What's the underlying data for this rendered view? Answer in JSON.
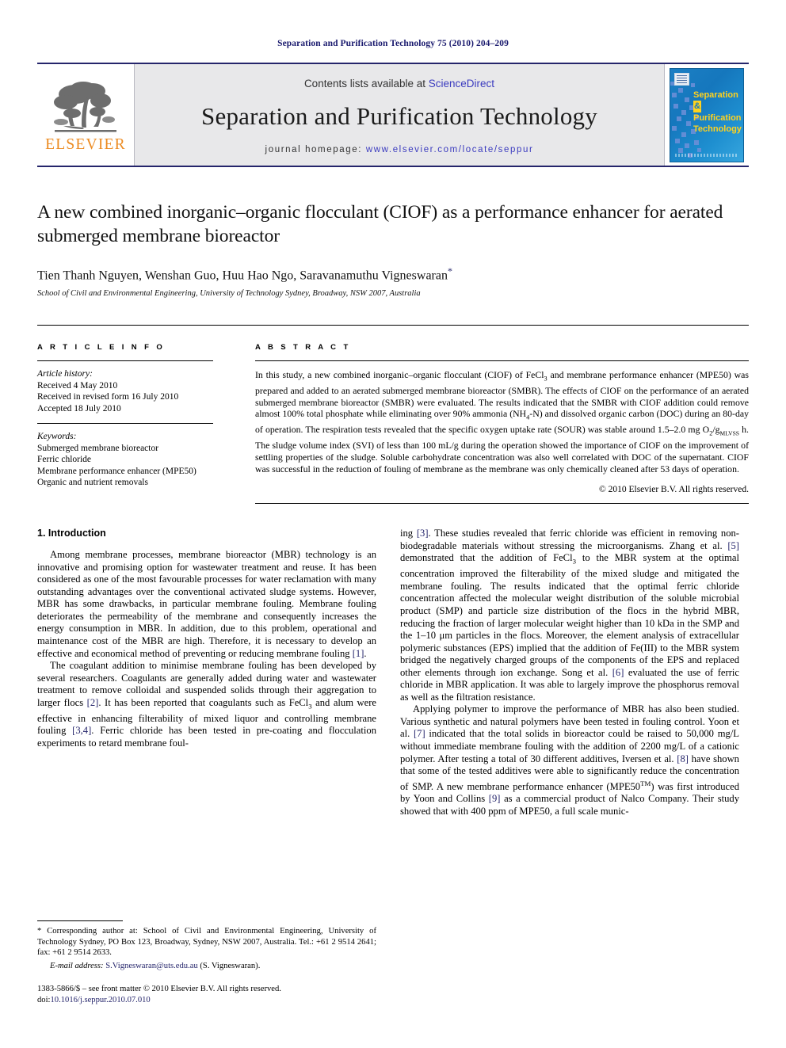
{
  "running_head": "Separation and Purification Technology 75 (2010) 204–209",
  "masthead": {
    "contents_prefix": "Contents lists available at ",
    "sciencedirect": "ScienceDirect",
    "journal_title": "Separation and Purification Technology",
    "homepage_label": "journal homepage:",
    "homepage_url": "www.elsevier.com/locate/seppur",
    "publisher_wordmark": "ELSEVIER",
    "publisher_color": "#ec8b22",
    "link_color": "#3b3bbf",
    "cover": {
      "line1": "Separation",
      "amp": "&",
      "line2": "Purification",
      "line3": "Technology",
      "text_color": "#ffd21e",
      "background_color": "#1577bd"
    }
  },
  "article": {
    "title": "A new combined inorganic–organic flocculant (CIOF) as a performance enhancer for aerated submerged membrane bioreactor",
    "authors": "Tien Thanh Nguyen, Wenshan Guo, Huu Hao Ngo, Saravanamuthu Vigneswaran",
    "corresponding_marker": "*",
    "affiliation": "School of Civil and Environmental Engineering, University of Technology Sydney, Broadway, NSW 2007, Australia"
  },
  "article_info": {
    "heading": "A R T I C L E    I N F O",
    "history_label": "Article history:",
    "history": [
      "Received 4 May 2010",
      "Received in revised form 16 July 2010",
      "Accepted 18 July 2010"
    ],
    "keywords_label": "Keywords:",
    "keywords": [
      "Submerged membrane bioreactor",
      "Ferric chloride",
      "Membrane performance enhancer (MPE50)",
      "Organic and nutrient removals"
    ]
  },
  "abstract": {
    "heading": "A B S T R A C T",
    "part1": "In this study, a new combined inorganic–organic flocculant (CIOF) of FeCl",
    "sub_3": "3",
    "part2": " and membrane performance enhancer (MPE50) was prepared and added to an aerated submerged membrane bioreactor (SMBR). The effects of CIOF on the performance of an aerated submerged membrane bioreactor (SMBR) were evaluated. The results indicated that the SMBR with CIOF addition could remove almost 100% total phosphate while eliminating over 90% ammonia (NH",
    "sub_4": "4",
    "part3": "-N) and dissolved organic carbon (DOC) during an 80-day of operation. The respiration tests revealed that the specific oxygen uptake rate (SOUR) was stable around 1.5–2.0 mg O",
    "sub_o2": "2",
    "part4": "/g",
    "sub_mlvss": "MLVSS",
    "part5": " h. The sludge volume index (SVI) of less than 100 mL/g during the operation showed the importance of CIOF on the improvement of settling properties of the sludge. Soluble carbohydrate concentration was also well correlated with DOC of the supernatant. CIOF was successful in the reduction of fouling of membrane as the membrane was only chemically cleaned after 53 days of operation.",
    "copyright": "© 2010 Elsevier B.V. All rights reserved."
  },
  "body": {
    "section_heading": "1. Introduction",
    "left": {
      "p1_a": "Among membrane processes, membrane bioreactor (MBR) technology is an innovative and promising option for wastewater treatment and reuse. It has been considered as one of the most favourable processes for water reclamation with many outstanding advantages over the conventional activated sludge systems. However, MBR has some drawbacks, in particular membrane fouling. Membrane fouling deteriorates the permeability of the membrane and consequently increases the energy consumption in MBR. In addition, due to this problem, operational and maintenance cost of the MBR are high. Therefore, it is necessary to develop an effective and economical method of preventing or reducing membrane fouling ",
      "p1_ref": "[1]",
      "p1_b": ".",
      "p2_a": "The coagulant addition to minimise membrane fouling has been developed by several researchers. Coagulants are generally added during water and wastewater treatment to remove colloidal and suspended solids through their aggregation to larger flocs ",
      "p2_ref1": "[2]",
      "p2_b": ". It has been reported that coagulants such as FeCl",
      "p2_sub": "3",
      "p2_c": " and alum were effective in enhancing filterability of mixed liquor and controlling membrane fouling ",
      "p2_ref2": "[3,4]",
      "p2_d": ". Ferric chloride has been tested in pre-coating and flocculation experiments to retard membrane foul-"
    },
    "right": {
      "p2_cont_a": "ing ",
      "p2_cont_ref": "[3]",
      "p2_cont_b": ". These studies revealed that ferric chloride was efficient in removing non-biodegradable materials without stressing the microorganisms. Zhang et al. ",
      "p2_cont_ref2": "[5]",
      "p2_cont_c": " demonstrated that the addition of FeCl",
      "p2_cont_sub": "3",
      "p2_cont_d": " to the MBR system at the optimal concentration improved the filterability of the mixed sludge and mitigated the membrane fouling. The results indicated that the optimal ferric chloride concentration affected the molecular weight distribution of the soluble microbial product (SMP) and particle size distribution of the flocs in the hybrid MBR, reducing the fraction of larger molecular weight higher than 10 kDa in the SMP and the 1–10 μm particles in the flocs. Moreover, the element analysis of extracellular polymeric substances (EPS) implied that the addition of Fe(III) to the MBR system bridged the negatively charged groups of the components of the EPS and replaced other elements through ion exchange. Song et al. ",
      "p2_cont_ref3": "[6]",
      "p2_cont_e": " evaluated the use of ferric chloride in MBR application. It was able to largely improve the phosphorus removal as well as the filtration resistance.",
      "p3_a": "Applying polymer to improve the performance of MBR has also been studied. Various synthetic and natural polymers have been tested in fouling control. Yoon et al. ",
      "p3_ref1": "[7]",
      "p3_b": " indicated that the total solids in bioreactor could be raised to 50,000 mg/L without immediate membrane fouling with the addition of 2200 mg/L of a cationic polymer. After testing a total of 30 different additives, Iversen et al. ",
      "p3_ref2": "[8]",
      "p3_c": " have shown that some of the tested additives were able to significantly reduce the concentration of SMP. A new membrane performance enhancer (MPE50",
      "p3_sup": "TM",
      "p3_d": ") was first introduced by Yoon and Collins ",
      "p3_ref3": "[9]",
      "p3_e": " as a commercial product of Nalco Company. Their study showed that with 400 ppm of MPE50, a full scale munic-"
    }
  },
  "footnote": {
    "star": "*",
    "corresponding": " Corresponding author at: School of Civil and Environmental Engineering, University of Technology Sydney, PO Box 123, Broadway, Sydney, NSW 2007, Australia. Tel.: +61 2 9514 2641; fax: +61 2 9514 2633.",
    "email_label": "E-mail address:",
    "email": "S.Vigneswaran@uts.edu.au",
    "email_suffix": " (S. Vigneswaran).",
    "frontmatter": "1383-5866/$ – see front matter © 2010 Elsevier B.V. All rights reserved.",
    "doi_label": "doi:",
    "doi": "10.1016/j.seppur.2010.07.010"
  }
}
